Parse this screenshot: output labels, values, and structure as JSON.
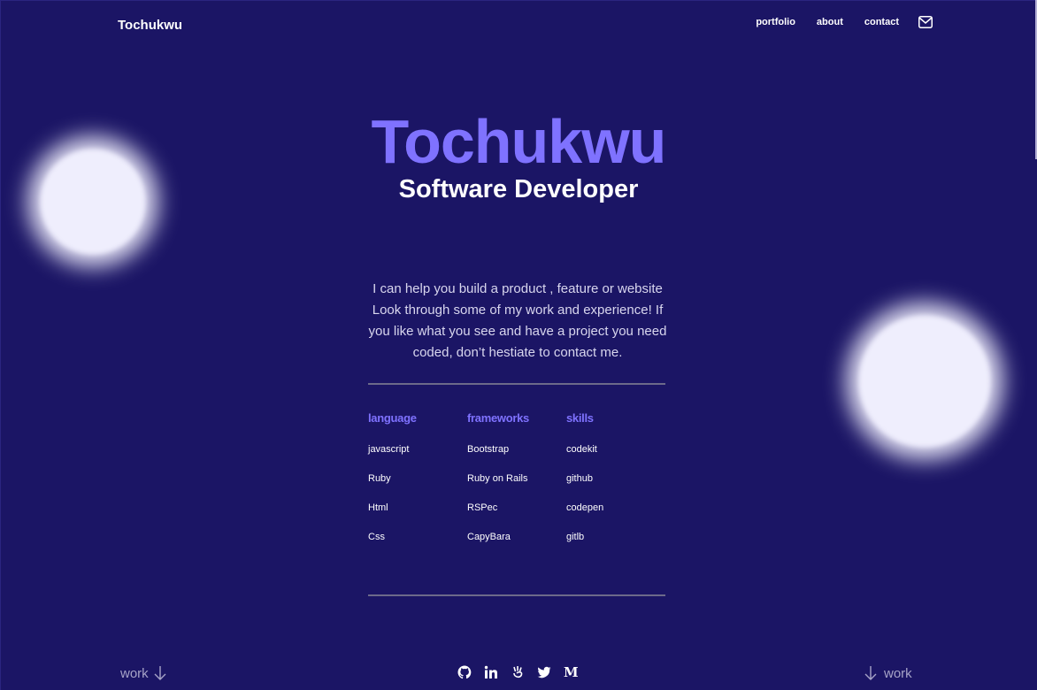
{
  "header": {
    "logo": "Tochukwu",
    "nav": [
      "portfolio",
      "about",
      "contact"
    ],
    "mail_icon": "mail-icon"
  },
  "hero": {
    "name": "Tochukwu",
    "role": "Software Developer",
    "intro": "I can help you build a product , feature or website Look through some of my work and experience! If you like what you see and have a project you need coded, don’t hestiate to contact me."
  },
  "skills": {
    "columns": [
      {
        "title": "language",
        "items": [
          "javascript",
          "Ruby",
          "Html",
          "Css"
        ]
      },
      {
        "title": "frameworks",
        "items": [
          "Bootstrap",
          "Ruby on Rails",
          "RSPec",
          "CapyBara"
        ]
      },
      {
        "title": "skills",
        "items": [
          "codekit",
          "github",
          "codepen",
          "gitlb"
        ]
      }
    ]
  },
  "footer": {
    "work_left": "work",
    "work_right": "work",
    "social_icons": [
      "github-icon",
      "linkedin-icon",
      "angellist-icon",
      "twitter-icon",
      "medium-icon"
    ],
    "medium_glyph": "M"
  },
  "colors": {
    "background": "#1b1565",
    "accent": "#7f72ff",
    "text": "#ffffff",
    "muted": "#a7a4c8"
  }
}
